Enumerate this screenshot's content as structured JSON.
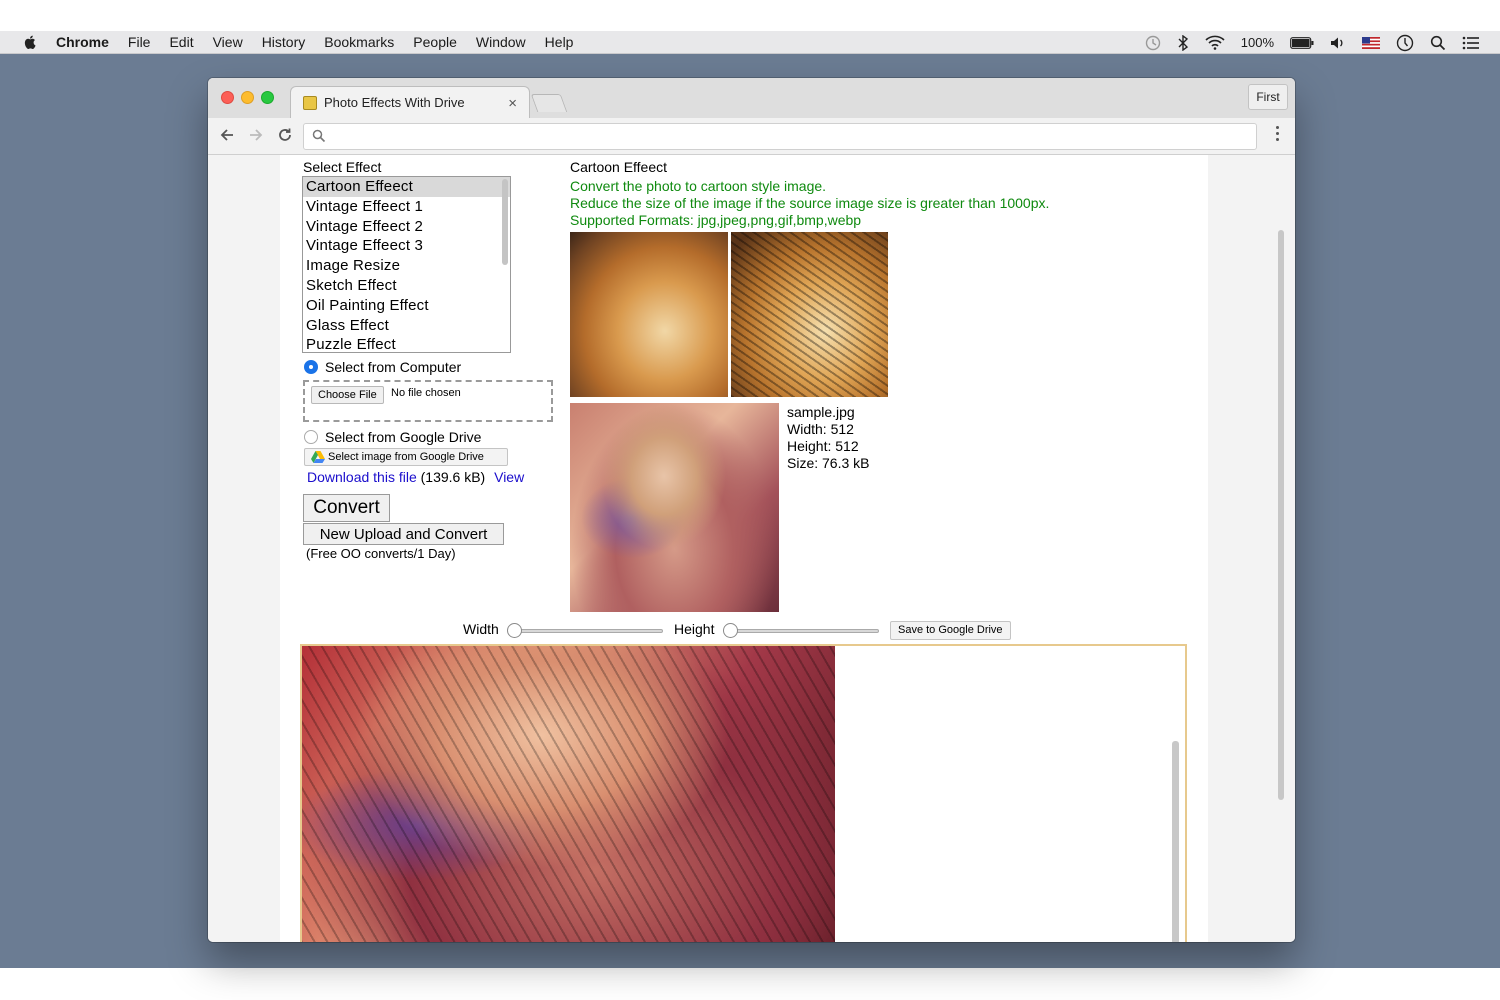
{
  "menubar": {
    "app": "Chrome",
    "items": [
      "File",
      "Edit",
      "View",
      "History",
      "Bookmarks",
      "People",
      "Window",
      "Help"
    ],
    "battery": "100%"
  },
  "browser": {
    "tab_title": "Photo Effects With Drive",
    "tab_close": "×",
    "profile": "First",
    "search_placeholder": ""
  },
  "sidebar": {
    "select_effect_label": "Select Effect",
    "effects": [
      "Cartoon Effeect",
      "Vintage Effeect 1",
      "Vintage Effeect 2",
      "Vintage Effeect 3",
      "Image Resize",
      "Sketch Effect",
      "Oil Painting Effect",
      "Glass Effect",
      "Puzzle Effect"
    ],
    "selected_effect": "Cartoon Effeect",
    "from_computer": "Select from Computer",
    "choose_file": "Choose File",
    "no_file": "No file chosen",
    "from_drive": "Select from Google Drive",
    "drive_button": "Select image from Google Drive",
    "download_link": "Download this file",
    "download_size": "(139.6 kB)",
    "view_link": "View",
    "convert": "Convert",
    "new_upload": "New Upload and Convert",
    "free_note": "(Free OO converts/1 Day)"
  },
  "main": {
    "effect_title": "Cartoon Effeect",
    "desc1": "Convert the photo to cartoon style image.",
    "desc2": "Reduce the size of the image if the source image size is greater than 1000px.",
    "desc3": "Supported Formats: jpg,jpeg,png,gif,bmp,webp",
    "file_name": "sample.jpg",
    "width_info": "Width: 512",
    "height_info": "Height: 512",
    "size_info": "Size: 76.3 kB",
    "width_label": "Width",
    "height_label": "Height",
    "save_drive": "Save to Google Drive"
  }
}
